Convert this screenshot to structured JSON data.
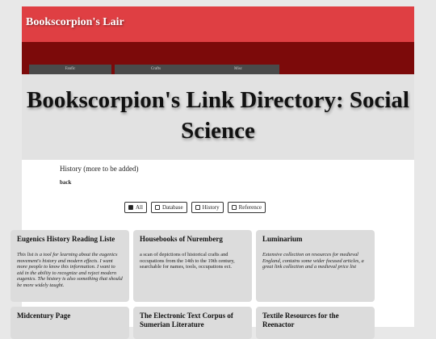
{
  "site": {
    "title": "Bookscorpion's Lair"
  },
  "nav": {
    "items": [
      "Fanfic",
      "Crafts",
      "Misc"
    ]
  },
  "hero": {
    "title": "Bookscorpion's Link Directory: Social Science"
  },
  "intro": {
    "text": "History (more to be added)",
    "back": "back"
  },
  "filters": {
    "items": [
      {
        "label": "All",
        "active": true
      },
      {
        "label": "Database",
        "active": false
      },
      {
        "label": "History",
        "active": false
      },
      {
        "label": "Reference",
        "active": false
      }
    ]
  },
  "cards": [
    {
      "title": "Eugenics History Reading Liste",
      "desc": "This list is a tool for learning about the eugenics movement's history and modern effects. I want more people to know this information. I want to aid in the ability to recognize and reject modern eugenics. The history is also something that should be more widely taught.",
      "italic": true
    },
    {
      "title": "Housebooks of Nuremberg",
      "desc": "a scan of depictions of historical crafts and occupations from the 14th to the 19th century, searchable for names, tools, occupations ect.",
      "italic": false
    },
    {
      "title": "Luminarium",
      "desc": "Extensive collection on resources for medieval England, contains some wider focused articles, a great link collection and a medieval price list",
      "italic": true
    },
    {
      "title": "Midcentury Page",
      "desc": "",
      "italic": false
    },
    {
      "title": "The Electronic Text Corpus of Sumerian Literature",
      "desc": "",
      "italic": false
    },
    {
      "title": "Textile Resources for the Reenactor",
      "desc": "",
      "italic": false
    }
  ]
}
